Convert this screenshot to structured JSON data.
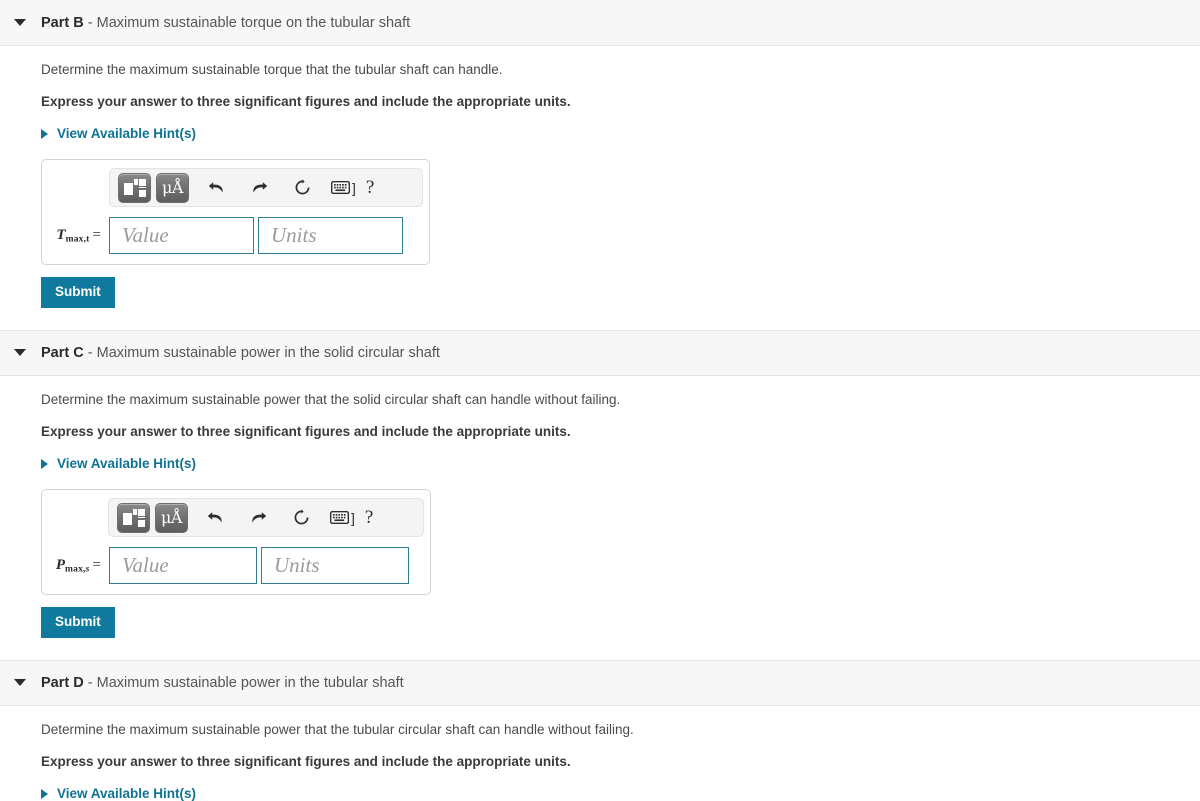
{
  "parts": [
    {
      "id": "part-b",
      "label": "Part B",
      "separator": " - ",
      "title": "Maximum sustainable torque on the tubular shaft",
      "caret_icon": "caret-down-icon",
      "prompt": "Determine the maximum sustainable torque that the tubular shaft can handle.",
      "instruction": "Express your answer to three significant figures and include the appropriate units.",
      "hint_link": "View Available Hint(s)",
      "variable": {
        "symbol": "T",
        "subscript": "max,t",
        "subscript_italic": "",
        "equals": "="
      },
      "value_placeholder": "Value",
      "units_placeholder": "Units",
      "value": "",
      "units": "",
      "submit_label": "Submit"
    },
    {
      "id": "part-c",
      "label": "Part C",
      "separator": " - ",
      "title": "Maximum sustainable power in the solid circular shaft",
      "caret_icon": "caret-down-icon",
      "prompt": "Determine the maximum sustainable power that the solid circular shaft can handle without failing.",
      "instruction": "Express your answer to three significant figures and include the appropriate units.",
      "hint_link": "View Available Hint(s)",
      "variable": {
        "symbol": "P",
        "subscript": "max,",
        "subscript_italic": "s",
        "equals": "="
      },
      "value_placeholder": "Value",
      "units_placeholder": "Units",
      "value": "",
      "units": "",
      "submit_label": "Submit"
    },
    {
      "id": "part-d",
      "label": "Part D",
      "separator": " - ",
      "title": "Maximum sustainable power in the tubular shaft",
      "caret_icon": "caret-down-icon",
      "prompt": "Determine the maximum sustainable power that the tubular circular shaft can handle without failing.",
      "instruction": "Express your answer to three significant figures and include the appropriate units.",
      "hint_link": "View Available Hint(s)"
    }
  ],
  "toolbar": {
    "template_button": "template-icon",
    "units_button": "μÅ",
    "undo": "undo-icon",
    "redo": "redo-icon",
    "reset": "reset-icon",
    "keyboard": "keyboard-icon",
    "keyboard_bracket": "]",
    "help": "?"
  },
  "colors": {
    "accent": "#0f7391",
    "submit": "#0f7a9d",
    "field_border": "#2e7f94",
    "header_bg": "#f7f7f7"
  }
}
